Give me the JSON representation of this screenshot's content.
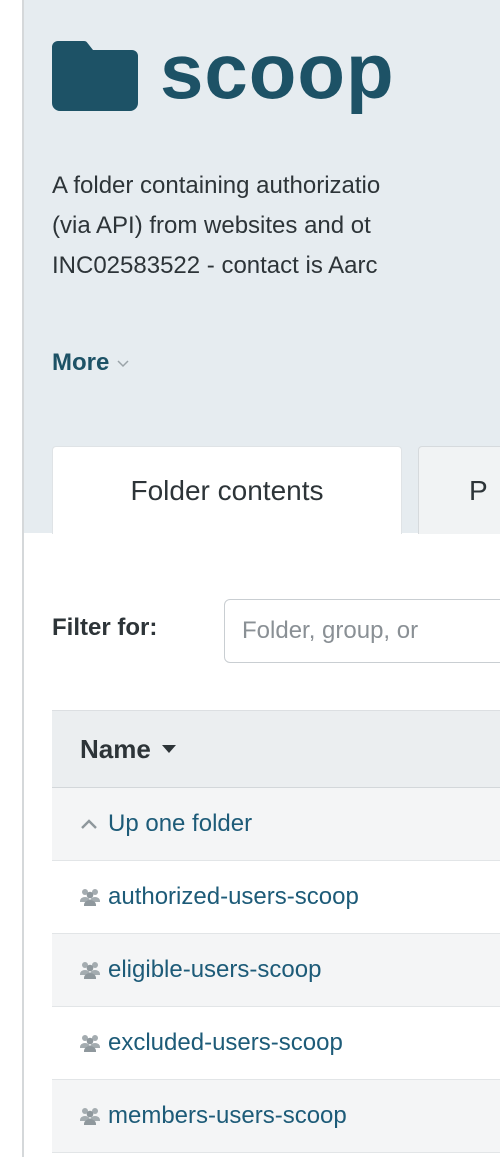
{
  "folder": {
    "icon": "folder-icon",
    "title": "scoop",
    "description_lines": [
      "A folder containing authorizatio",
      "(via API) from websites and ot",
      "INC02583522 - contact is Aarc"
    ],
    "more_label": "More"
  },
  "tabs": [
    {
      "label": "Folder contents",
      "active": true
    },
    {
      "label": "P",
      "active": false
    }
  ],
  "filter": {
    "label": "Filter for:",
    "placeholder": "Folder, group, or"
  },
  "table": {
    "header": {
      "name_label": "Name",
      "sort_icon": "caret-down-icon"
    },
    "up_folder": {
      "label": "Up one folder",
      "icon": "chevron-up-icon"
    },
    "rows": [
      {
        "label": "authorized-users-scoop",
        "icon": "group-icon"
      },
      {
        "label": "eligible-users-scoop",
        "icon": "group-icon"
      },
      {
        "label": "excluded-users-scoop",
        "icon": "group-icon"
      },
      {
        "label": "members-users-scoop",
        "icon": "group-icon"
      }
    ]
  },
  "colors": {
    "brand": "#1d5266",
    "header_band": "#e6ecf0",
    "link": "#1d5b78"
  }
}
